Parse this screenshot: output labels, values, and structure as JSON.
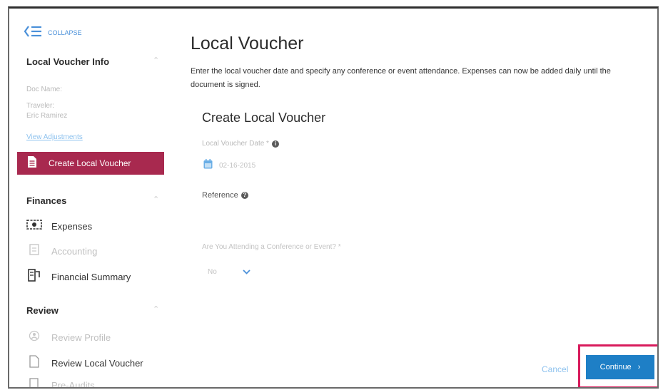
{
  "sidebar": {
    "collapse_label": "COLLAPSE",
    "section1": {
      "title": "Local Voucher Info",
      "doc_name_label": "Doc Name:",
      "traveler_label": "Traveler:",
      "traveler_name": "Eric Ramirez",
      "view_adjustments": "View Adjustments",
      "active_item": "Create Local Voucher"
    },
    "finances": {
      "title": "Finances",
      "items": [
        {
          "label": "Expenses"
        },
        {
          "label": "Accounting"
        },
        {
          "label": "Financial Summary"
        }
      ]
    },
    "review": {
      "title": "Review",
      "items": [
        {
          "label": "Review Profile"
        },
        {
          "label": "Review Local Voucher"
        },
        {
          "label": "Pre-Audits"
        }
      ]
    }
  },
  "main": {
    "title": "Local Voucher",
    "description_line1": "Enter the local voucher date and specify any conference or event attendance. Expenses can now be added daily until the",
    "description_line2": "document is signed.",
    "form_title": "Create Local Voucher",
    "date_label": "Local Voucher Date *",
    "date_value": "02-16-2015",
    "reference_label": "Reference",
    "conference_label": "Are You Attending a Conference or Event? *",
    "conference_value": "No"
  },
  "footer": {
    "cancel_label": "Cancel",
    "continue_label": "Continue"
  },
  "colors": {
    "active_item_bg": "#a8294f",
    "accent_blue": "#1e7fc6",
    "highlight_border": "#d81b5c",
    "link_blue": "#6aaee6"
  }
}
